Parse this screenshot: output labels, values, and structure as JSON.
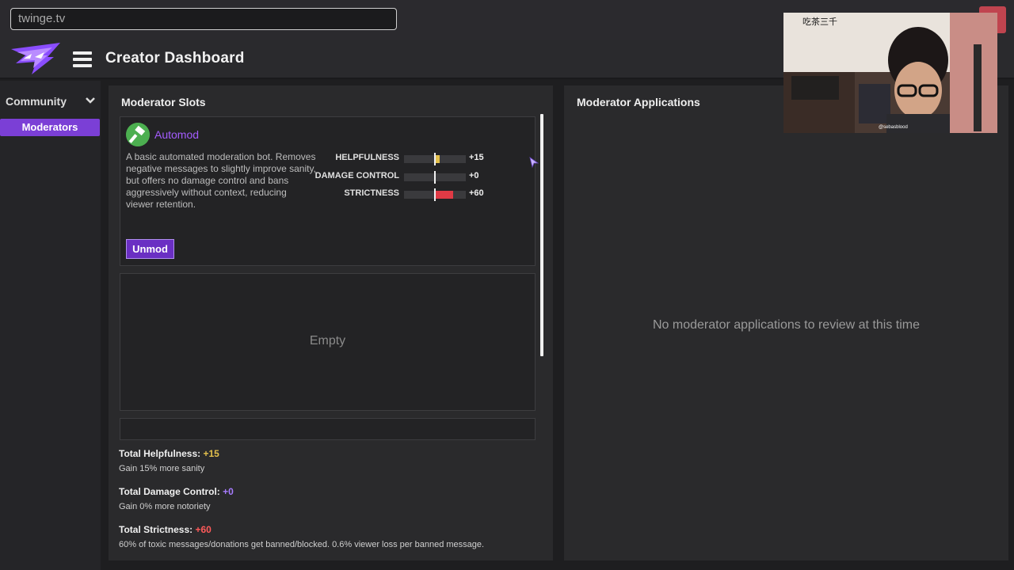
{
  "browser": {
    "url": "twinge.tv"
  },
  "header": {
    "title": "Creator Dashboard"
  },
  "sidebar": {
    "section_label": "Community",
    "items": [
      {
        "label": "Moderators",
        "active": true
      }
    ]
  },
  "moderator_slots": {
    "title": "Moderator Slots",
    "slots": [
      {
        "name": "Automod",
        "description": "A basic automated moderation bot. Removes negative messages to slightly improve sanity, but offers no damage control and bans aggressively without context, reducing viewer retention.",
        "button_label": "Unmod",
        "stats": [
          {
            "label": "HELPFULNESS",
            "value": "+15",
            "level": 15,
            "color": "#e3c04c"
          },
          {
            "label": "DAMAGE CONTROL",
            "value": "+0",
            "level": 0,
            "color": "#a77cff"
          },
          {
            "label": "STRICTNESS",
            "value": "+60",
            "level": 60,
            "color": "#e03a45"
          }
        ]
      },
      {
        "empty_label": "Empty"
      }
    ]
  },
  "totals": {
    "helpfulness": {
      "label": "Total Helpfulness:",
      "value": "+15",
      "desc": "Gain 15% more sanity"
    },
    "damage_control": {
      "label": "Total Damage Control:",
      "value": "+0",
      "desc": "Gain 0% more notoriety"
    },
    "strictness": {
      "label": "Total Strictness:",
      "value": "+60",
      "desc": "60% of toxic messages/donations get banned/blocked. 0.6% viewer loss per banned message."
    }
  },
  "moderator_applications": {
    "title": "Moderator Applications",
    "empty_message": "No moderator applications to review at this time"
  },
  "webcam": {
    "tag": "吃茶三千",
    "handle": "@sebasblood"
  },
  "colors": {
    "accent": "#7b3fd6",
    "helpfulness": "#e3c04c",
    "damage_control": "#a77cff",
    "strictness": "#ff5a5a"
  },
  "icons": [
    "hamburger-icon",
    "chevron-down-icon",
    "hammer-icon",
    "logo-icon",
    "mouse-cursor-icon"
  ]
}
